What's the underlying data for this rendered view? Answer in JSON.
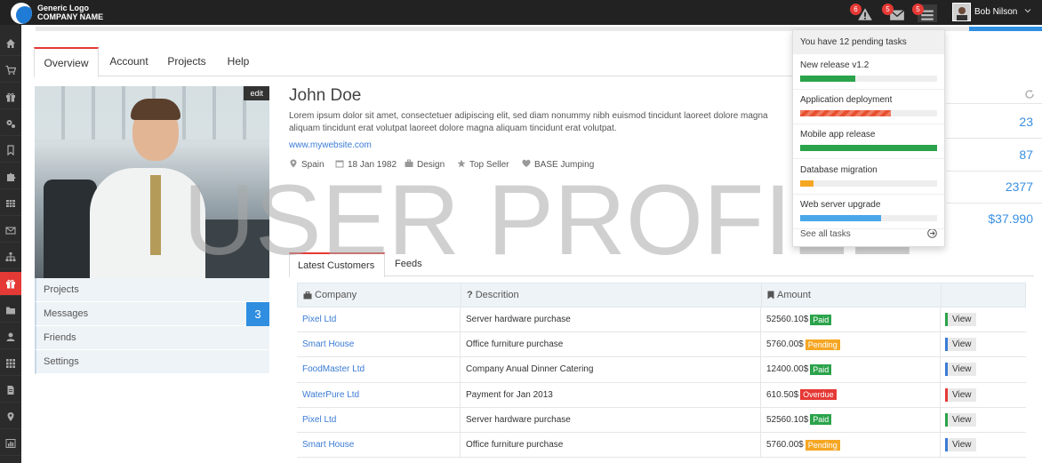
{
  "topbar": {
    "logo_line1": "Generic Logo",
    "logo_line2": "COMPANY NAME",
    "alerts_count": "6",
    "messages_count": "5",
    "tasks_count": "5",
    "username": "Bob Nilson"
  },
  "sidebar": {
    "items": [
      {
        "icon": "home-icon"
      },
      {
        "icon": "cart-icon"
      },
      {
        "icon": "gift-icon"
      },
      {
        "icon": "gears-icon"
      },
      {
        "icon": "bookmark-icon"
      },
      {
        "icon": "puzzle-icon"
      },
      {
        "icon": "table-icon"
      },
      {
        "icon": "envelope-icon"
      },
      {
        "icon": "sitemap-icon"
      },
      {
        "icon": "gift-icon",
        "active": true
      },
      {
        "icon": "folder-icon"
      },
      {
        "icon": "user-icon"
      },
      {
        "icon": "grid-icon"
      },
      {
        "icon": "file-icon"
      },
      {
        "icon": "map-marker-icon"
      },
      {
        "icon": "bar-chart-icon"
      }
    ],
    "active_color": "#e53935"
  },
  "tabs": [
    {
      "label": "Overview",
      "active": true
    },
    {
      "label": "Account"
    },
    {
      "label": "Projects"
    },
    {
      "label": "Help"
    }
  ],
  "profile": {
    "edit_label": "edit",
    "name": "John Doe",
    "description": "Lorem ipsum dolor sit amet, consectetuer adipiscing elit, sed diam nonummy nibh euismod tincidunt laoreet dolore magna aliquam tincidunt erat volutpat laoreet dolore magna aliquam tincidunt erat volutpat.",
    "website": "www.mywebsite.com",
    "meta": {
      "location": "Spain",
      "birthdate": "18 Jan 1982",
      "job": "Design",
      "rank": "Top Seller",
      "hobby": "BASE Jumping"
    }
  },
  "side_menu": {
    "projects": "Projects",
    "messages": "Messages",
    "messages_count": "3",
    "friends": "Friends",
    "settings": "Settings"
  },
  "stats": [
    "23",
    "87",
    "2377",
    "$37.990"
  ],
  "watermark": "USER PROFILE",
  "subtabs": [
    {
      "label": "Latest Customers",
      "active": true
    },
    {
      "label": "Feeds"
    }
  ],
  "table": {
    "headers": {
      "company": "Company",
      "description": "Descrition",
      "amount": "Amount"
    },
    "view_label": "View",
    "rows": [
      {
        "company": "Pixel Ltd",
        "description": "Server hardware purchase",
        "amount": "52560.10$",
        "status": "Paid",
        "status_color": "#2aa34a",
        "view_color": "#2aa34a"
      },
      {
        "company": "Smart House",
        "description": "Office furniture purchase",
        "amount": "5760.00$",
        "status": "Pending",
        "status_color": "#f5a623",
        "view_color": "#3a7bd5"
      },
      {
        "company": "FoodMaster Ltd",
        "description": "Company Anual Dinner Catering",
        "amount": "12400.00$",
        "status": "Paid",
        "status_color": "#2aa34a",
        "view_color": "#3a7bd5"
      },
      {
        "company": "WaterPure Ltd",
        "description": "Payment for Jan 2013",
        "amount": "610.50$",
        "status": "Overdue",
        "status_color": "#e53935",
        "view_color": "#e53935"
      },
      {
        "company": "Pixel Ltd",
        "description": "Server hardware purchase",
        "amount": "52560.10$",
        "status": "Paid",
        "status_color": "#2aa34a",
        "view_color": "#2aa34a"
      },
      {
        "company": "Smart House",
        "description": "Office furniture purchase",
        "amount": "5760.00$",
        "status": "Pending",
        "status_color": "#f5a623",
        "view_color": "#3a7bd5"
      }
    ]
  },
  "tasks_dropdown": {
    "header": "You have 12 pending tasks",
    "footer": "See all tasks",
    "tasks": [
      {
        "label": "New release v1.2",
        "progress": 0.4,
        "color": "#2aa34a"
      },
      {
        "label": "Application deployment",
        "progress": 0.66,
        "color": "#e8502f"
      },
      {
        "label": "Mobile app release",
        "progress": 1.0,
        "color": "#2aa34a"
      },
      {
        "label": "Database migration",
        "progress": 0.1,
        "color": "#f5a623"
      },
      {
        "label": "Web server upgrade",
        "progress": 0.59,
        "color": "#4aa8e8"
      }
    ]
  }
}
